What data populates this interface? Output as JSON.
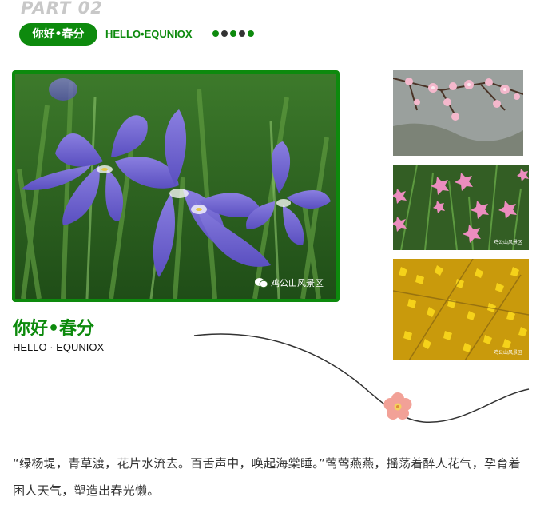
{
  "header": {
    "part_label": "PART 02",
    "pill_label": "你好•春分",
    "hello_text": "HELLO•EQUNIOX",
    "dot_colors": [
      "#0d8a0d",
      "#333333",
      "#0d8a0d",
      "#333333",
      "#0d8a0d"
    ]
  },
  "main_image": {
    "subject": "purple iris flowers",
    "watermark": "鸡公山风景区"
  },
  "side_images": [
    {
      "subject": "peach blossom branch",
      "watermark": ""
    },
    {
      "subject": "pink rain lilies",
      "watermark": "鸡公山风景区"
    },
    {
      "subject": "yellow forsythia",
      "watermark": "鸡公山风景区"
    }
  ],
  "section": {
    "title": "你好•春分",
    "subtitle": "HELLO · EQUNIOX"
  },
  "decoration": {
    "flower_icon": "plum-blossom-icon",
    "curve_color": "#333333"
  },
  "body_text": "“绿杨堤，青草渡，花片水流去。百舌声中，唤起海棠睡。”莺莺燕燕，摇荡着醉人花气，孕育着困人天气，塑造出春光懒。",
  "colors": {
    "brand_green": "#0d8a0d"
  }
}
